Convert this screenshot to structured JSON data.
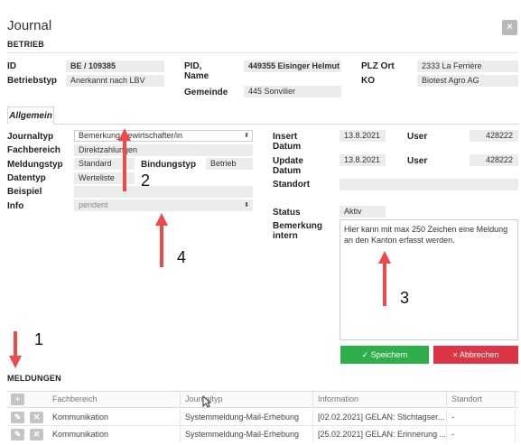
{
  "dialog": {
    "title": "Journal",
    "close_icon": "×"
  },
  "betrieb": {
    "section_title": "BETRIEB",
    "labels": {
      "id": "ID",
      "betriebstyp": "Betriebstyp",
      "pid_name": "PID, Name",
      "gemeinde": "Gemeinde",
      "plz_ort": "PLZ Ort",
      "ko": "KO"
    },
    "values": {
      "id": "BE / 109385",
      "betriebstyp": "Anerkannt nach LBV",
      "pid_name": "449355 Eisinger Helmut",
      "gemeinde": "445 Sonvilier",
      "plz_ort": "2333 La Ferrière",
      "ko": "Biotest Agro AG"
    }
  },
  "tabs": [
    "Allgemein"
  ],
  "form": {
    "labels": {
      "journaltyp": "Journaltyp",
      "fachbereich": "Fachbereich",
      "meldungstyp": "Meldungstyp",
      "bindungstyp": "Bindungstyp",
      "datentyp": "Datentyp",
      "beispiel": "Beispiel",
      "info": "Info",
      "insert_datum": "Insert Datum",
      "update_datum": "Update Datum",
      "user": "User",
      "standort": "Standort",
      "status": "Status",
      "bemerkung_intern": "Bemerkung intern"
    },
    "values": {
      "journaltyp": "Bemerkung Bewirtschafter/in",
      "fachbereich": "Direktzahlungen",
      "meldungstyp": "Standard",
      "bindungstyp": "Betrieb",
      "datentyp": "Werteliste",
      "beispiel": "",
      "info": "pendent",
      "insert_datum": "13.8.2021",
      "insert_user": "428222",
      "update_datum": "13.8.2021",
      "update_user": "428222",
      "standort": "",
      "status": "Aktiv",
      "bemerkung_intern": "Hier kann mit max 250 Zeichen eine Meldung an den Kanton erfasst werden."
    },
    "save_label": "Speichern",
    "cancel_label": "Abbrechen"
  },
  "meldungen": {
    "section_title": "MELDUNGEN",
    "columns": [
      "Fachbereich",
      "Journaltyp",
      "Information",
      "Standort"
    ],
    "rows": [
      {
        "fachbereich": "Kommunikation",
        "journaltyp": "Systemmeldung-Mail-Erhebung",
        "information": "[02.02.2021] GELAN: Stichtagser...",
        "standort": "-"
      },
      {
        "fachbereich": "Kommunikation",
        "journaltyp": "Systemmeldung-Mail-Erhebung",
        "information": "[25.02.2021] GELAN: Erinnerung ...",
        "standort": "-"
      }
    ]
  },
  "annotations": [
    "1",
    "2",
    "3",
    "4"
  ],
  "colors": {
    "save": "#2eaf4b",
    "cancel": "#dc3545",
    "arrow": "#ec4b4b",
    "field_bg": "#ececec"
  },
  "icons": {
    "add": "+",
    "edit": "✎",
    "delete": "✕",
    "check": "✓",
    "close": "×",
    "caret": "⬍"
  }
}
